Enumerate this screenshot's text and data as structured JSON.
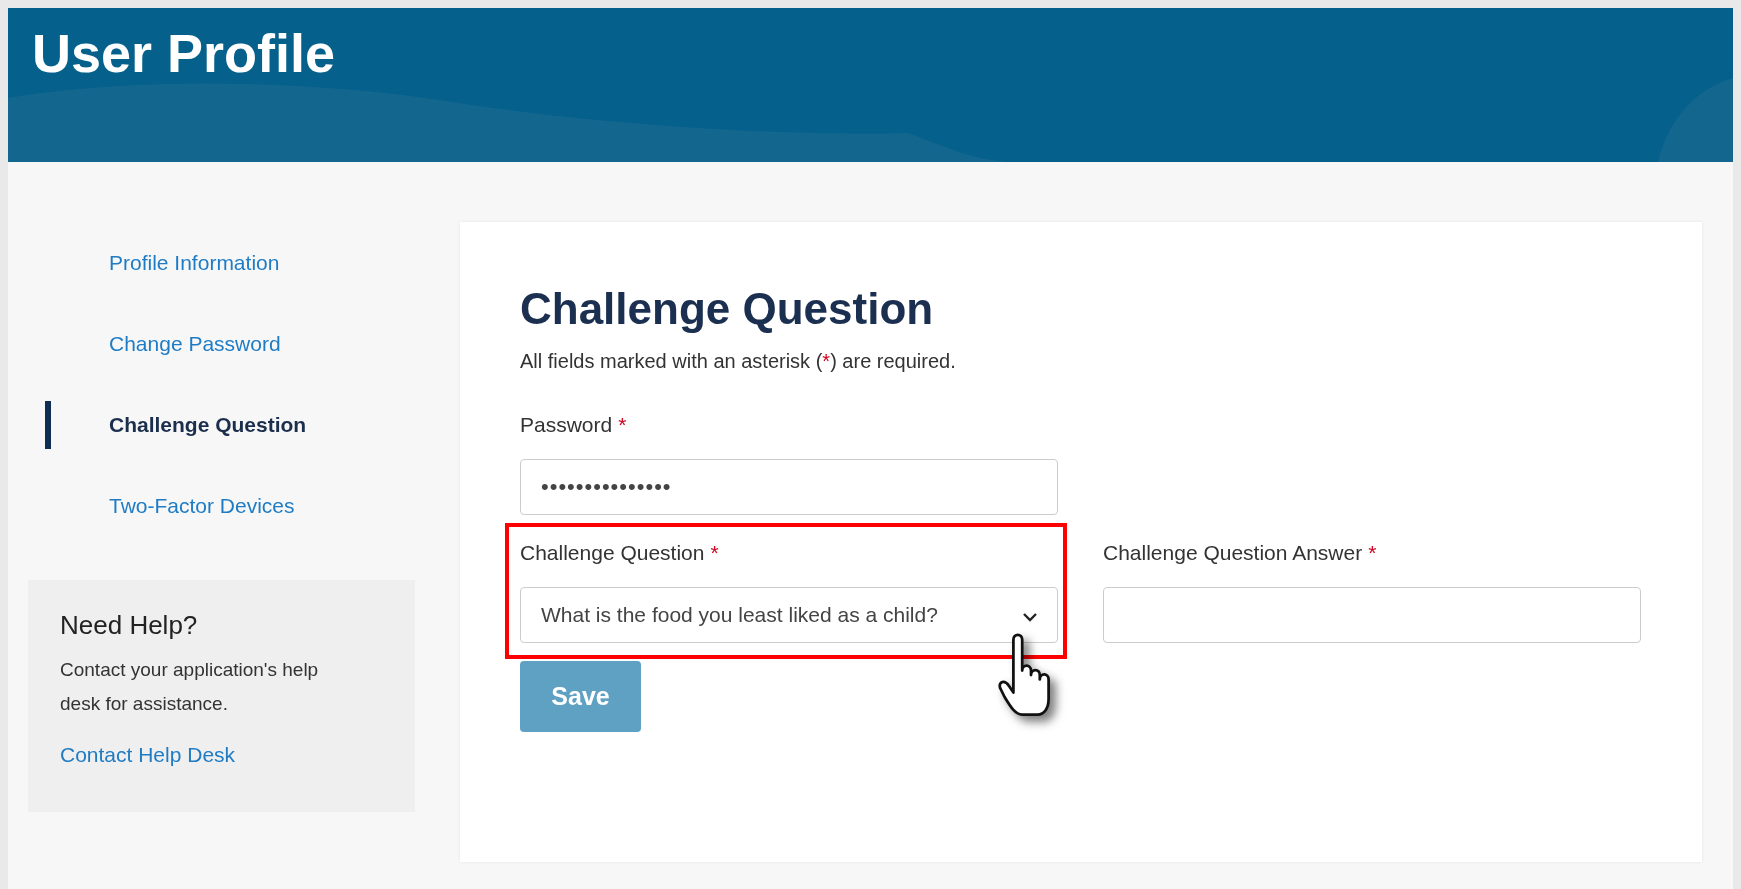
{
  "header": {
    "title": "User Profile"
  },
  "sidebar": {
    "items": [
      {
        "label": "Profile Information",
        "selected": false
      },
      {
        "label": "Change Password",
        "selected": false
      },
      {
        "label": "Challenge Question",
        "selected": true
      },
      {
        "label": "Two-Factor Devices",
        "selected": false
      }
    ],
    "help": {
      "title": "Need Help?",
      "text": "Contact your application's help desk for assistance.",
      "link": "Contact Help Desk"
    }
  },
  "form": {
    "title": "Challenge Question",
    "note": {
      "before": "All fields marked with an asterisk (",
      "mark": "*",
      "after": ") are required."
    },
    "password": {
      "label": "Password",
      "required_mark": "*",
      "value": "•••••••••••••••"
    },
    "question": {
      "label": "Challenge Question",
      "required_mark": "*",
      "value": "What is the food you least liked as a child?",
      "highlighted": true
    },
    "answer": {
      "label": "Challenge Question Answer",
      "required_mark": "*"
    },
    "save": {
      "label": "Save",
      "disabled": true
    }
  }
}
